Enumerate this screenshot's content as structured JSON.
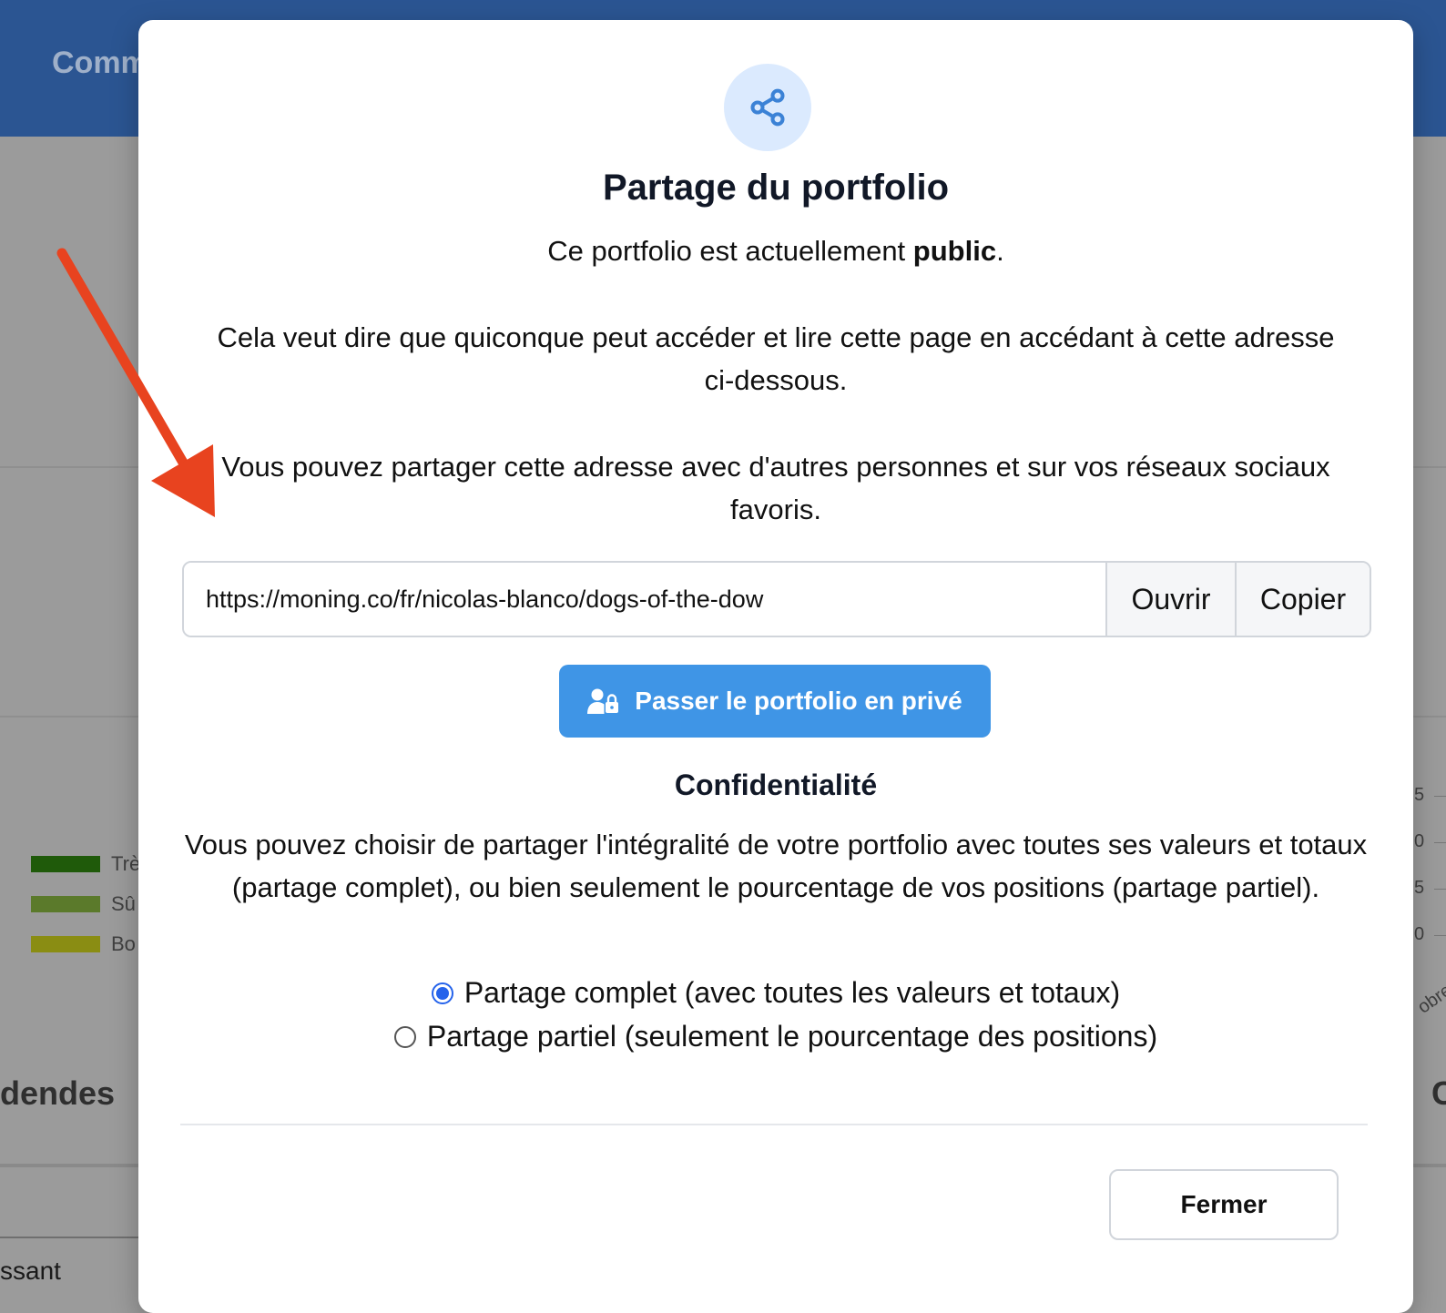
{
  "background": {
    "header_text": "Comm",
    "legend": [
      {
        "label": "Trè",
        "color": "#1f5a0a"
      },
      {
        "label": "Sû",
        "color": "#5b7a2b"
      },
      {
        "label": "Bo",
        "color": "#8a8d13"
      }
    ],
    "section_heading": "dendes",
    "axis_ticks": [
      "5",
      "0",
      "5",
      "0"
    ],
    "rotated_label": "obre",
    "right_heading": "C",
    "bottom_text": "ssant"
  },
  "modal": {
    "icon": "share-icon",
    "title": "Partage du portfolio",
    "status_prefix": "Ce portfolio est actuellement ",
    "status_value": "public",
    "status_suffix": ".",
    "description": "Cela veut dire que quiconque peut accéder et lire cette page en accédant à cette adresse ci-dessous.",
    "share_hint": "Vous pouvez partager cette adresse avec d'autres personnes et sur vos réseaux sociaux favoris.",
    "url": {
      "value": "https://moning.co/fr/nicolas-blanco/dogs-of-the-dow",
      "open_label": "Ouvrir",
      "copy_label": "Copier"
    },
    "private_button": {
      "icon": "user-lock-icon",
      "label": "Passer le portfolio en privé",
      "color": "#3f95e6"
    },
    "privacy": {
      "title": "Confidentialité",
      "description": "Vous pouvez choisir de partager l'intégralité de votre portfolio avec toutes ses valeurs et totaux (partage complet), ou bien seulement le pourcentage de vos positions (partage partiel).",
      "options": [
        {
          "label": "Partage complet (avec toutes les valeurs et totaux)",
          "selected": true
        },
        {
          "label": "Partage partiel (seulement le pourcentage des positions)",
          "selected": false
        }
      ]
    },
    "close_label": "Fermer"
  },
  "annotation": {
    "arrow_color": "#e8431f"
  }
}
